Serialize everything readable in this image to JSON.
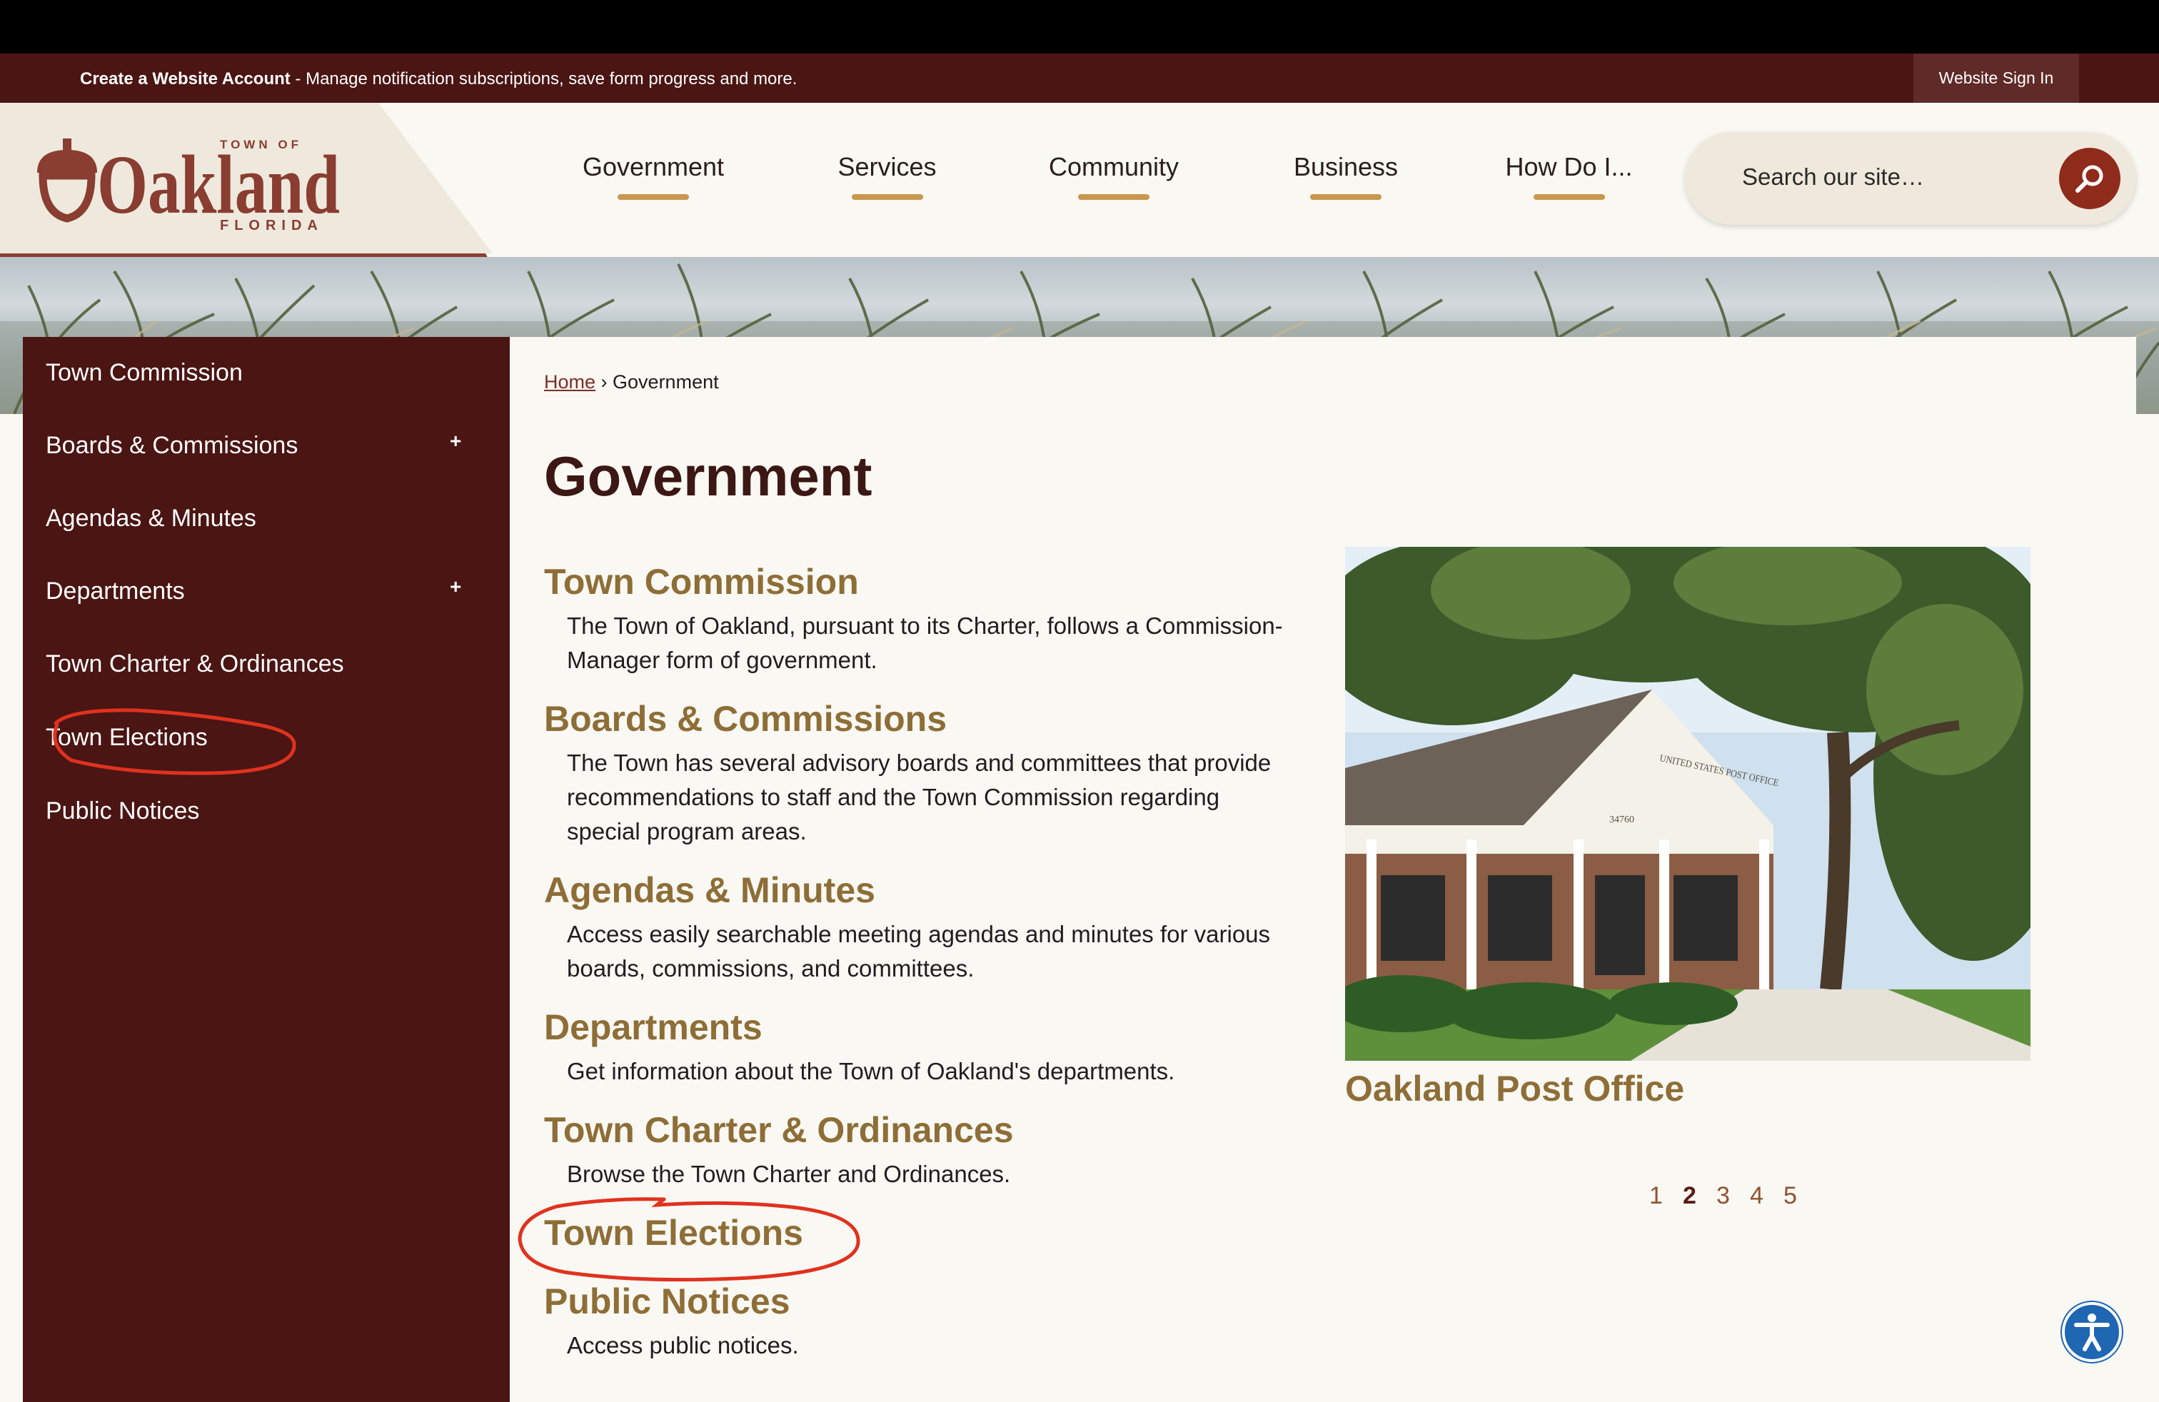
{
  "topbar": {
    "account_link": "Create a Website Account",
    "message": " - Manage notification subscriptions, save form progress and more.",
    "signin_label": "Website Sign In"
  },
  "logo": {
    "town_of": "TOWN OF",
    "name": "Oakland",
    "state": "FLORIDA",
    "color": "#8a3d31"
  },
  "nav": {
    "items": [
      {
        "label": "Government"
      },
      {
        "label": "Services"
      },
      {
        "label": "Community"
      },
      {
        "label": "Business"
      },
      {
        "label": "How Do I..."
      }
    ]
  },
  "search": {
    "placeholder": "Search our site…",
    "icon": "search-icon"
  },
  "sidebar": {
    "items": [
      {
        "label": "Town Commission"
      },
      {
        "label": "Boards & Commissions",
        "expand": "+"
      },
      {
        "label": "Agendas & Minutes"
      },
      {
        "label": "Departments",
        "expand": "+"
      },
      {
        "label": "Town Charter & Ordinances"
      },
      {
        "label": "Town Elections"
      },
      {
        "label": "Public Notices"
      }
    ]
  },
  "breadcrumb": {
    "home": "Home",
    "separator": " › ",
    "current": "Government"
  },
  "page": {
    "title": "Government",
    "sections": [
      {
        "title": "Town Commission",
        "desc": "The Town of Oakland, pursuant to its Charter, follows a Commission-Manager form of government."
      },
      {
        "title": "Boards & Commissions",
        "desc": "The Town has several advisory boards and committees that provide recommendations to staff and the Town Commission regarding special program areas."
      },
      {
        "title": "Agendas & Minutes",
        "desc": "Access easily searchable meeting agendas and minutes for various boards, commissions, and committees."
      },
      {
        "title": "Departments",
        "desc": "Get information about the Town of Oakland's departments."
      },
      {
        "title": "Town Charter & Ordinances",
        "desc": "Browse the Town Charter and Ordinances."
      },
      {
        "title": "Town Elections",
        "desc": ""
      },
      {
        "title": "Public Notices",
        "desc": "Access public notices."
      }
    ]
  },
  "slideshow": {
    "caption": "Oakland Post Office",
    "sign_text": "UNITED STATES POST OFFICE",
    "zip": "34760",
    "pages": [
      "1",
      "2",
      "3",
      "4",
      "5"
    ],
    "active_page": "2"
  },
  "accessibility": {
    "icon": "accessibility-icon"
  },
  "colors": {
    "maroon": "#4a1513",
    "gold": "#8e6e37",
    "accent_bar": "#c9974e",
    "search_button": "#8f2b1b",
    "annotation_red": "#e0321f"
  }
}
